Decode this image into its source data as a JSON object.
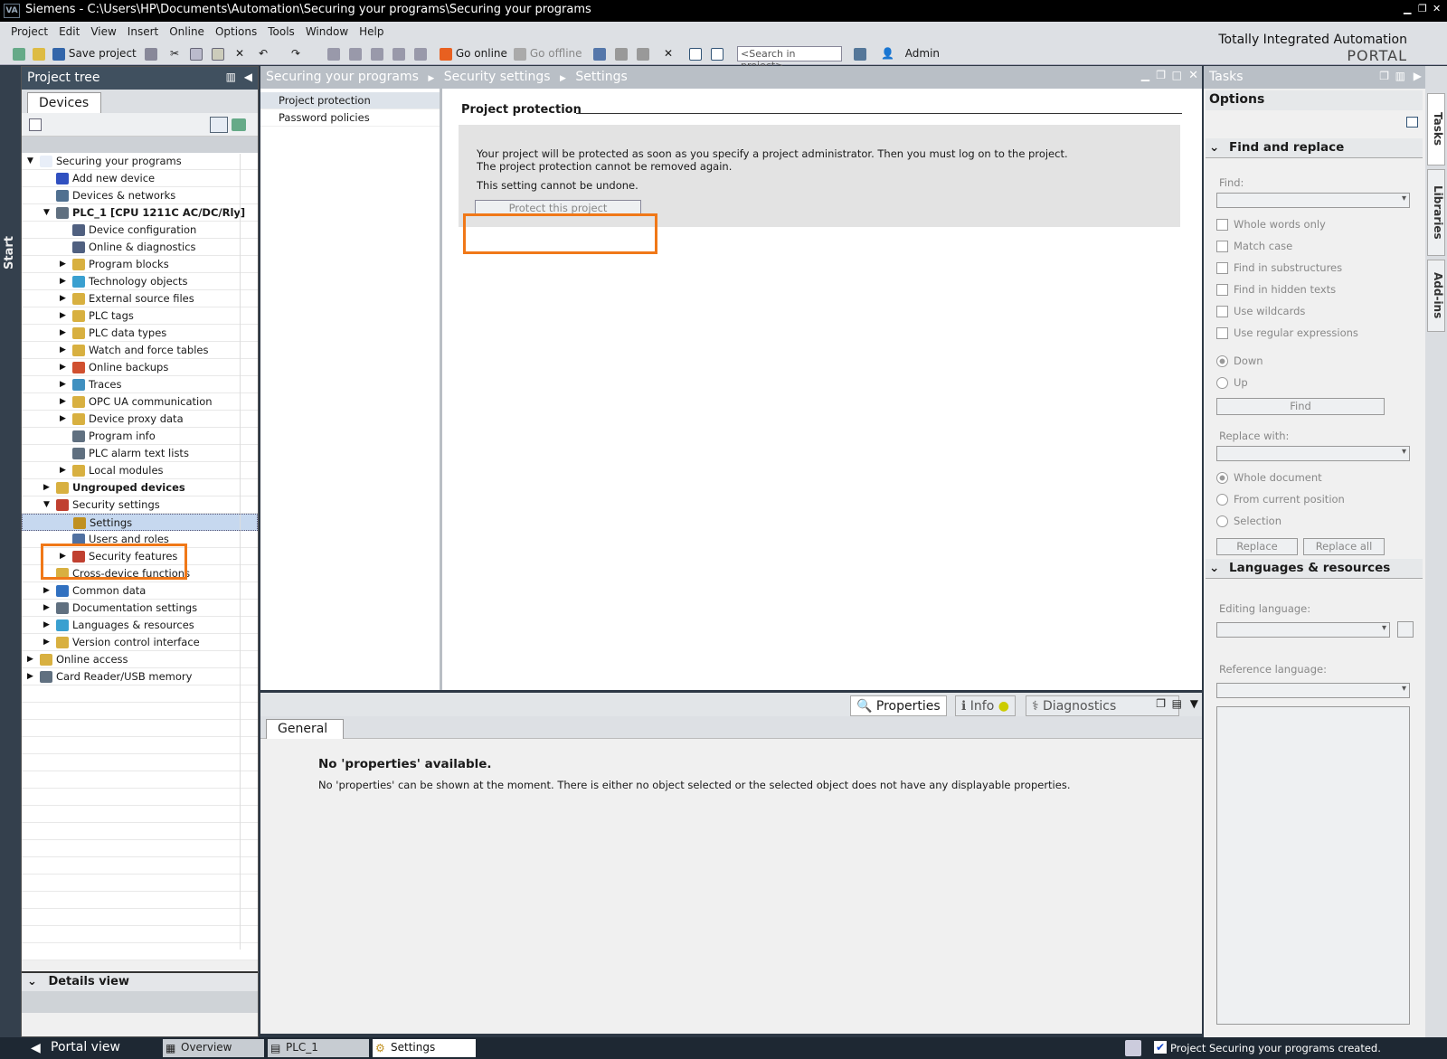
{
  "titlebar": {
    "title": "Siemens  -  C:\\Users\\HP\\Documents\\Automation\\Securing your programs\\Securing your programs",
    "logo": "VA"
  },
  "menu": [
    "Project",
    "Edit",
    "View",
    "Insert",
    "Online",
    "Options",
    "Tools",
    "Window",
    "Help"
  ],
  "toolbar": {
    "save_label": "Save project",
    "go_online": "Go online",
    "go_offline": "Go offline",
    "search_placeholder": "<Search in project>",
    "user": "Admin"
  },
  "brand": {
    "line1": "Totally Integrated Automation",
    "line2": "PORTAL"
  },
  "start_label": "Start",
  "project_tree": {
    "title": "Project tree",
    "devices_tab": "Devices",
    "items": [
      {
        "label": "Securing your programs",
        "level": 0,
        "exp": "▼",
        "color": "#e8eef8"
      },
      {
        "label": "Add new device",
        "level": 1,
        "exp": "",
        "color": "#3050c0"
      },
      {
        "label": "Devices & networks",
        "level": 1,
        "exp": "",
        "color": "#507090"
      },
      {
        "label": "PLC_1 [CPU 1211C AC/DC/Rly]",
        "level": 1,
        "exp": "▼",
        "color": "#607080",
        "bold": true
      },
      {
        "label": "Device configuration",
        "level": 2,
        "exp": "",
        "color": "#506080"
      },
      {
        "label": "Online & diagnostics",
        "level": 2,
        "exp": "",
        "color": "#506080"
      },
      {
        "label": "Program blocks",
        "level": 2,
        "exp": "▶",
        "color": "#d8b040"
      },
      {
        "label": "Technology objects",
        "level": 2,
        "exp": "▶",
        "color": "#3aa0d0"
      },
      {
        "label": "External source files",
        "level": 2,
        "exp": "▶",
        "color": "#d8b040"
      },
      {
        "label": "PLC tags",
        "level": 2,
        "exp": "▶",
        "color": "#d8b040"
      },
      {
        "label": "PLC data types",
        "level": 2,
        "exp": "▶",
        "color": "#d8b040"
      },
      {
        "label": "Watch and force tables",
        "level": 2,
        "exp": "▶",
        "color": "#d8b040"
      },
      {
        "label": "Online backups",
        "level": 2,
        "exp": "▶",
        "color": "#d05030"
      },
      {
        "label": "Traces",
        "level": 2,
        "exp": "▶",
        "color": "#4090c0"
      },
      {
        "label": "OPC UA communication",
        "level": 2,
        "exp": "▶",
        "color": "#d8b040"
      },
      {
        "label": "Device proxy data",
        "level": 2,
        "exp": "▶",
        "color": "#d8b040"
      },
      {
        "label": "Program info",
        "level": 2,
        "exp": "",
        "color": "#607080"
      },
      {
        "label": "PLC alarm text lists",
        "level": 2,
        "exp": "",
        "color": "#607080"
      },
      {
        "label": "Local modules",
        "level": 2,
        "exp": "▶",
        "color": "#d8b040"
      },
      {
        "label": "Ungrouped devices",
        "level": 1,
        "exp": "▶",
        "color": "#d8b040",
        "bold": true
      },
      {
        "label": "Security settings",
        "level": 1,
        "exp": "▼",
        "color": "#c04030"
      },
      {
        "label": "Settings",
        "level": 2,
        "exp": "",
        "color": "#c09020",
        "selected": true
      },
      {
        "label": "Users and roles",
        "level": 2,
        "exp": "",
        "color": "#5070a0"
      },
      {
        "label": "Security features",
        "level": 2,
        "exp": "▶",
        "color": "#c04030"
      },
      {
        "label": "Cross-device functions",
        "level": 1,
        "exp": "",
        "color": "#d8b040"
      },
      {
        "label": "Common data",
        "level": 1,
        "exp": "▶",
        "color": "#3070c0"
      },
      {
        "label": "Documentation settings",
        "level": 1,
        "exp": "▶",
        "color": "#607080"
      },
      {
        "label": "Languages & resources",
        "level": 1,
        "exp": "▶",
        "color": "#3aa0d0"
      },
      {
        "label": "Version control interface",
        "level": 1,
        "exp": "▶",
        "color": "#d8b040"
      },
      {
        "label": "Online access",
        "level": 0,
        "exp": "▶",
        "color": "#d8b040"
      },
      {
        "label": "Card Reader/USB memory",
        "level": 0,
        "exp": "▶",
        "color": "#607080"
      }
    ],
    "details_view": "Details view"
  },
  "editor": {
    "breadcrumb": [
      "Securing your programs",
      "Security settings",
      "Settings"
    ],
    "nav": [
      "Project protection",
      "Password policies"
    ],
    "section_title": "Project protection",
    "info_text": "Your project will be protected as soon as you specify a project administrator. Then you must log on to the project. The project protection cannot be removed again.",
    "warning_text": "This setting cannot be undone.",
    "protect_button": "Protect this project"
  },
  "inspector": {
    "tabs": [
      "Properties",
      "Info",
      "Diagnostics"
    ],
    "general_tab": "General",
    "no_props_title": "No 'properties' available.",
    "no_props_text": "No 'properties' can be shown at the moment. There is either no object selected or the selected object does not have any displayable properties."
  },
  "tasks": {
    "title": "Tasks",
    "options": "Options",
    "find_replace": "Find and replace",
    "find_label": "Find:",
    "checkboxes": [
      "Whole words only",
      "Match case",
      "Find in substructures",
      "Find in hidden texts",
      "Use wildcards",
      "Use regular expressions"
    ],
    "direction": [
      "Down",
      "Up"
    ],
    "find_button": "Find",
    "replace_with": "Replace with:",
    "scope": [
      "Whole document",
      "From current position",
      "Selection"
    ],
    "replace_button": "Replace",
    "replace_all_button": "Replace all",
    "languages": "Languages & resources",
    "editing_language": "Editing language:",
    "reference_language": "Reference language:"
  },
  "side_tabs": [
    "Tasks",
    "Libraries",
    "Add-ins"
  ],
  "statusbar": {
    "portal_view": "Portal view",
    "tabs": [
      "Overview",
      "PLC_1",
      "Settings"
    ],
    "message": "Project Securing your programs created."
  }
}
